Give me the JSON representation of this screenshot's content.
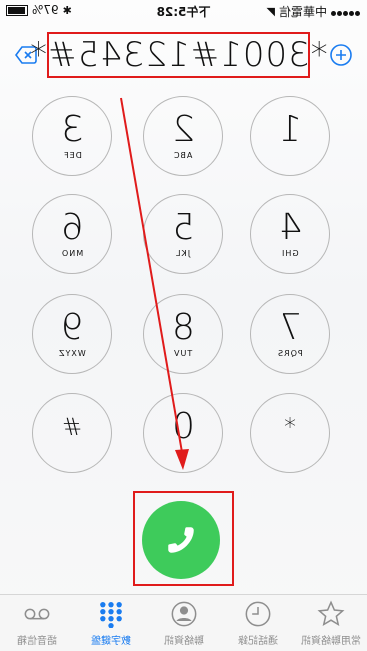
{
  "status_bar": {
    "carrier": "中華電信",
    "time": "下午5:28",
    "battery_percent": "97%"
  },
  "dial_entry": {
    "number": "*3001#12345#*"
  },
  "keypad": [
    {
      "digit": "1",
      "letters": ""
    },
    {
      "digit": "2",
      "letters": "ABC"
    },
    {
      "digit": "3",
      "letters": "DEF"
    },
    {
      "digit": "4",
      "letters": "GHI"
    },
    {
      "digit": "5",
      "letters": "JKL"
    },
    {
      "digit": "6",
      "letters": "MNO"
    },
    {
      "digit": "7",
      "letters": "PQRS"
    },
    {
      "digit": "8",
      "letters": "TUV"
    },
    {
      "digit": "9",
      "letters": "WXYZ"
    },
    {
      "digit": "*",
      "letters": ""
    },
    {
      "digit": "0",
      "letters": "+"
    },
    {
      "digit": "#",
      "letters": ""
    }
  ],
  "tabs": [
    {
      "label": "常用聯絡資訊",
      "icon": "star-icon"
    },
    {
      "label": "通話記錄",
      "icon": "clock-icon"
    },
    {
      "label": "聯絡資訊",
      "icon": "contact-icon"
    },
    {
      "label": "數字鍵盤",
      "icon": "keypad-icon",
      "active": true
    },
    {
      "label": "語音信箱",
      "icon": "voicemail-icon"
    }
  ],
  "colors": {
    "accent": "#1a7cf0",
    "call_green": "#3ecb5b",
    "highlight_red": "#e01b1b"
  }
}
